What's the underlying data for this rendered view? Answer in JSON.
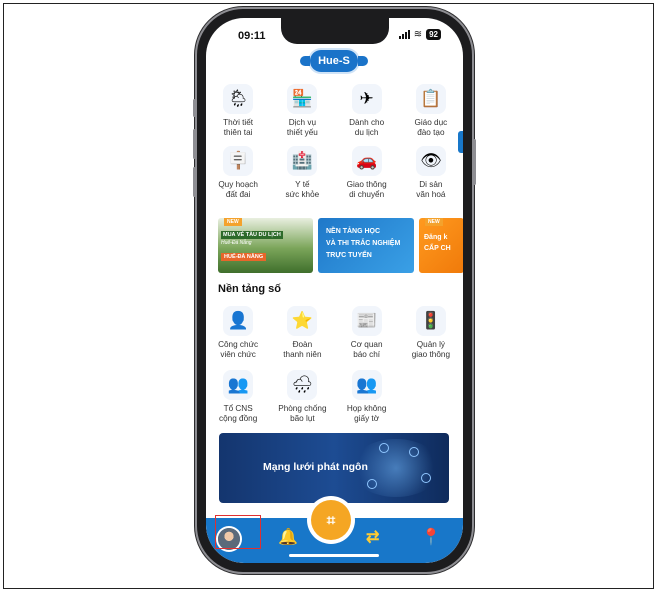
{
  "status_bar": {
    "time": "09:11",
    "battery": "92"
  },
  "app": {
    "logo_text": "Hue-S"
  },
  "services": [
    {
      "icon": "weather-icon",
      "glyph": "🌦",
      "label": "Thời tiết\nthiên tai"
    },
    {
      "icon": "essential-services-icon",
      "glyph": "🏪",
      "label": "Dịch vụ\nthiết yếu"
    },
    {
      "icon": "airplane-icon",
      "glyph": "✈",
      "label": "Dành cho\ndu lịch"
    },
    {
      "icon": "education-icon",
      "glyph": "📋",
      "label": "Giáo dục\nđào tạo"
    },
    {
      "icon": "signpost-icon",
      "glyph": "🪧",
      "label": "Quy hoạch\nđất đai"
    },
    {
      "icon": "hospital-icon",
      "glyph": "🏥",
      "label": "Y tế\nsức khỏe"
    },
    {
      "icon": "car-icon",
      "glyph": "🚗",
      "label": "Giao thông\ndi chuyển"
    },
    {
      "icon": "heritage-icon",
      "glyph": "👁",
      "label": "Di sản\nvăn hoá"
    }
  ],
  "banners": [
    {
      "tag": "NEW",
      "line1": "MUA VÉ TÀU DU LỊCH",
      "line2": "Huế-Đà Nẵng",
      "line3": "HUẾ-ĐÀ NẴNG"
    },
    {
      "text": "NỀN TẢNG HỌC\nVÀ THI TRẮC NGHIỆM\nTRỰC TUYẾN"
    },
    {
      "tag": "NEW",
      "text": "Đăng k\nCẤP CH"
    }
  ],
  "digital_section": {
    "title": "Nền tảng số",
    "items": [
      {
        "icon": "civil-servant-icon",
        "glyph": "👤",
        "label": "Công chức\nviên chức"
      },
      {
        "icon": "youth-union-icon",
        "glyph": "⭐",
        "label": "Đoàn\nthanh niên"
      },
      {
        "icon": "press-agency-icon",
        "glyph": "📰",
        "label": "Cơ quan\nbáo chí"
      },
      {
        "icon": "traffic-management-icon",
        "glyph": "🚦",
        "label": "Quản lý\ngiao thông"
      },
      {
        "icon": "cns-community-icon",
        "glyph": "👥",
        "label": "Tổ CNS\ncộng đồng"
      },
      {
        "icon": "flood-prevention-icon",
        "glyph": "🌧",
        "label": "Phòng chống\nbão lụt"
      },
      {
        "icon": "paperless-meeting-icon",
        "glyph": "👥",
        "label": "Họp không\ngiấy tờ"
      }
    ]
  },
  "promo_banner": {
    "text": "Mạng lưới phát ngôn"
  },
  "tabbar": {
    "bell_glyph": "🔔",
    "qr_glyph": "⌗",
    "exchange_glyph": "⇄",
    "location_glyph": "📍"
  }
}
